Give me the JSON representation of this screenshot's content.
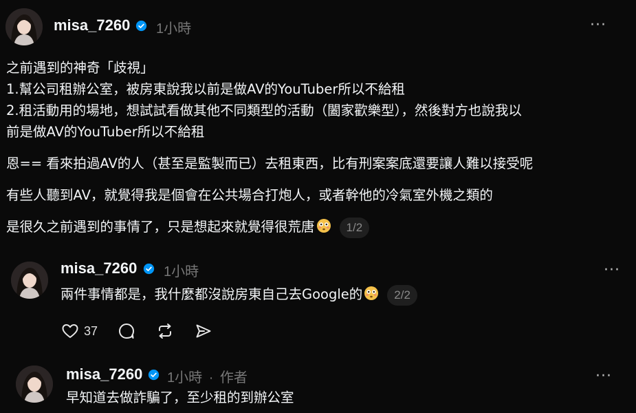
{
  "post": {
    "username": "misa_7260",
    "time": "1小時",
    "lines": [
      "之前遇到的神奇「歧視」",
      "1.幫公司租辦公室，被房東說我以前是做AV的YouTuber所以不給租",
      "2.租活動用的場地，想試試看做其他不同類型的活動（闔家歡樂型），然後對方也說我以",
      "前是做AV的YouTuber所以不給租",
      "恩== 看來拍過AV的人（甚至是監製而已）去租東西，比有刑案案底還要讓人難以接受呢",
      "有些人聽到AV，就覺得我是個會在公共場合打炮人，或者幹他的冷氣室外機之類的",
      "是很久之前遇到的事情了，只是想起來就覺得很荒唐"
    ],
    "page_badge": "1/2"
  },
  "reply1": {
    "username": "misa_7260",
    "time": "1小時",
    "text": "兩件事情都是，我什麼都沒說房東自己去Google的",
    "page_badge": "2/2",
    "like_count": "37"
  },
  "reply2": {
    "username": "misa_7260",
    "time": "1小時",
    "separator": "·",
    "author_tag": "作者",
    "text": "早知道去做詐騙了，至少租的到辦公室"
  },
  "more_label": "···",
  "colors": {
    "verified": "#0095f6",
    "background": "#0a0a0a",
    "muted": "#777777",
    "emoji": "#f5c14a"
  },
  "icons": {
    "like": "heart-icon",
    "comment": "comment-icon",
    "repost": "repost-icon",
    "share": "send-icon"
  }
}
